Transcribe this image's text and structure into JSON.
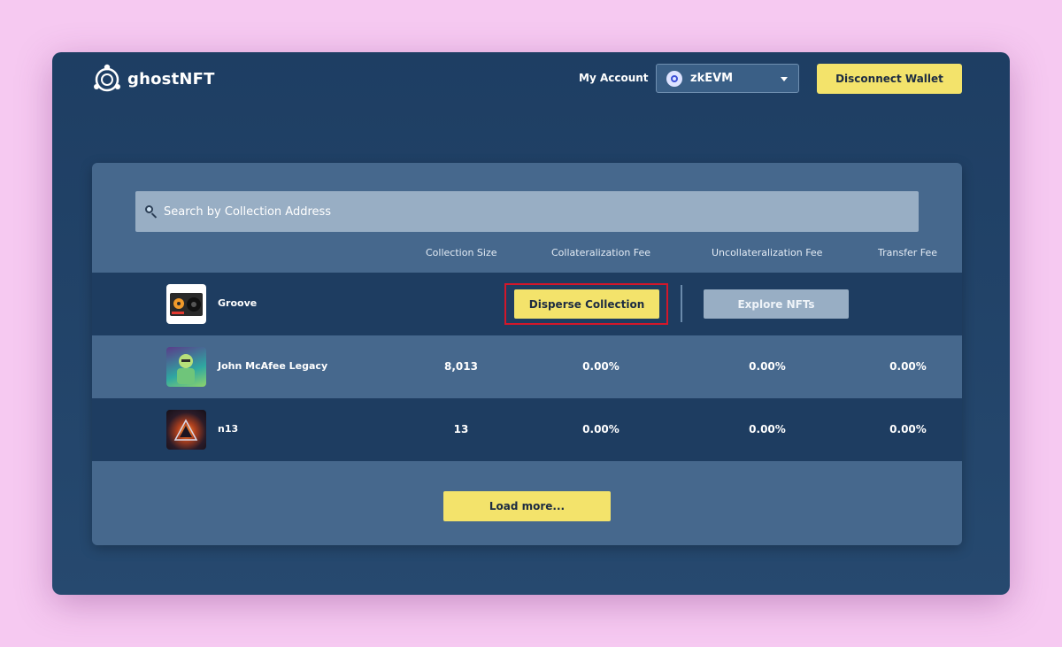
{
  "header": {
    "logo_text": "ghostNFT",
    "my_account": "My Account",
    "network": "zkEVM",
    "disconnect_label": "Disconnect Wallet"
  },
  "search": {
    "placeholder": "Search by Collection Address"
  },
  "columns": [
    "Collection Size",
    "Collateralization Fee",
    "Uncollateralization Fee",
    "Transfer Fee"
  ],
  "rows": [
    {
      "name": "Groove",
      "actions": {
        "disperse": "Disperse Collection",
        "explore": "Explore NFTs"
      }
    },
    {
      "name": "John McAfee Legacy",
      "size": "8,013",
      "collat_fee": "0.00%",
      "uncollat_fee": "0.00%",
      "transfer_fee": "0.00%"
    },
    {
      "name": "n13",
      "size": "13",
      "collat_fee": "0.00%",
      "uncollat_fee": "0.00%",
      "transfer_fee": "0.00%"
    }
  ],
  "load_more": "Load more...",
  "colors": {
    "accent": "#f3e36b",
    "background": "#1e3e63",
    "panel": "#46688d",
    "highlight": "#d3172a"
  }
}
